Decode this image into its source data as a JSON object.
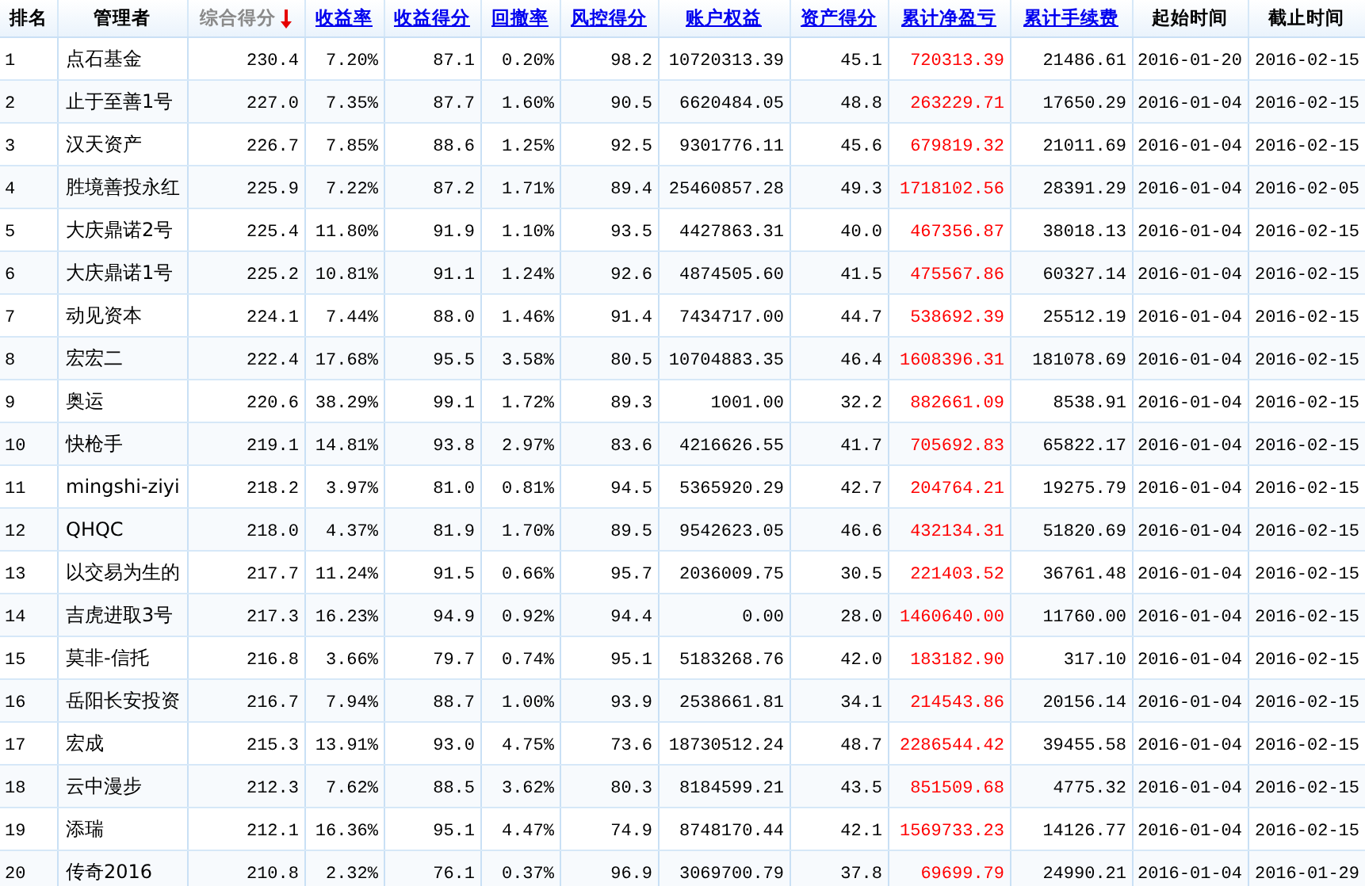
{
  "table": {
    "columns": [
      {
        "label": "排名",
        "kind": "plain",
        "highlighted": false
      },
      {
        "label": "管理者",
        "kind": "plain",
        "highlighted": false
      },
      {
        "label": "综合得分",
        "kind": "sorted",
        "highlighted": false
      },
      {
        "label": "收益率",
        "kind": "link",
        "highlighted": false
      },
      {
        "label": "收益得分",
        "kind": "link",
        "highlighted": false
      },
      {
        "label": "回撤率",
        "kind": "link",
        "highlighted": false
      },
      {
        "label": "风控得分",
        "kind": "link",
        "highlighted": false
      },
      {
        "label": "账户权益",
        "kind": "link",
        "highlighted": false
      },
      {
        "label": "资产得分",
        "kind": "link",
        "highlighted": false
      },
      {
        "label": "累计净盈亏",
        "kind": "link",
        "highlighted": true
      },
      {
        "label": "累计手续费",
        "kind": "link",
        "highlighted": false
      },
      {
        "label": "起始时间",
        "kind": "plain",
        "highlighted": false
      },
      {
        "label": "截止时间",
        "kind": "plain",
        "highlighted": false
      }
    ],
    "rows": [
      [
        "1",
        "点石基金",
        "230.4",
        "7.20%",
        "87.1",
        "0.20%",
        "98.2",
        "10720313.39",
        "45.1",
        "720313.39",
        "21486.61",
        "2016-01-20",
        "2016-02-15"
      ],
      [
        "2",
        "止于至善1号",
        "227.0",
        "7.35%",
        "87.7",
        "1.60%",
        "90.5",
        "6620484.05",
        "48.8",
        "263229.71",
        "17650.29",
        "2016-01-04",
        "2016-02-15"
      ],
      [
        "3",
        "汉天资产",
        "226.7",
        "7.85%",
        "88.6",
        "1.25%",
        "92.5",
        "9301776.11",
        "45.6",
        "679819.32",
        "21011.69",
        "2016-01-04",
        "2016-02-15"
      ],
      [
        "4",
        "胜境善投永红",
        "225.9",
        "7.22%",
        "87.2",
        "1.71%",
        "89.4",
        "25460857.28",
        "49.3",
        "1718102.56",
        "28391.29",
        "2016-01-04",
        "2016-02-05"
      ],
      [
        "5",
        "大庆鼎诺2号",
        "225.4",
        "11.80%",
        "91.9",
        "1.10%",
        "93.5",
        "4427863.31",
        "40.0",
        "467356.87",
        "38018.13",
        "2016-01-04",
        "2016-02-15"
      ],
      [
        "6",
        "大庆鼎诺1号",
        "225.2",
        "10.81%",
        "91.1",
        "1.24%",
        "92.6",
        "4874505.60",
        "41.5",
        "475567.86",
        "60327.14",
        "2016-01-04",
        "2016-02-15"
      ],
      [
        "7",
        "动见资本",
        "224.1",
        "7.44%",
        "88.0",
        "1.46%",
        "91.4",
        "7434717.00",
        "44.7",
        "538692.39",
        "25512.19",
        "2016-01-04",
        "2016-02-15"
      ],
      [
        "8",
        "宏宏二",
        "222.4",
        "17.68%",
        "95.5",
        "3.58%",
        "80.5",
        "10704883.35",
        "46.4",
        "1608396.31",
        "181078.69",
        "2016-01-04",
        "2016-02-15"
      ],
      [
        "9",
        "奥运",
        "220.6",
        "38.29%",
        "99.1",
        "1.72%",
        "89.3",
        "1001.00",
        "32.2",
        "882661.09",
        "8538.91",
        "2016-01-04",
        "2016-02-15"
      ],
      [
        "10",
        "快枪手",
        "219.1",
        "14.81%",
        "93.8",
        "2.97%",
        "83.6",
        "4216626.55",
        "41.7",
        "705692.83",
        "65822.17",
        "2016-01-04",
        "2016-02-15"
      ],
      [
        "11",
        "mingshi-ziyi",
        "218.2",
        "3.97%",
        "81.0",
        "0.81%",
        "94.5",
        "5365920.29",
        "42.7",
        "204764.21",
        "19275.79",
        "2016-01-04",
        "2016-02-15"
      ],
      [
        "12",
        "QHQC",
        "218.0",
        "4.37%",
        "81.9",
        "1.70%",
        "89.5",
        "9542623.05",
        "46.6",
        "432134.31",
        "51820.69",
        "2016-01-04",
        "2016-02-15"
      ],
      [
        "13",
        "以交易为生的",
        "217.7",
        "11.24%",
        "91.5",
        "0.66%",
        "95.7",
        "2036009.75",
        "30.5",
        "221403.52",
        "36761.48",
        "2016-01-04",
        "2016-02-15"
      ],
      [
        "14",
        "吉虎进取3号",
        "217.3",
        "16.23%",
        "94.9",
        "0.92%",
        "94.4",
        "0.00",
        "28.0",
        "1460640.00",
        "11760.00",
        "2016-01-04",
        "2016-02-15"
      ],
      [
        "15",
        "莫非-信托",
        "216.8",
        "3.66%",
        "79.7",
        "0.74%",
        "95.1",
        "5183268.76",
        "42.0",
        "183182.90",
        "317.10",
        "2016-01-04",
        "2016-02-15"
      ],
      [
        "16",
        "岳阳长安投资",
        "216.7",
        "7.94%",
        "88.7",
        "1.00%",
        "93.9",
        "2538661.81",
        "34.1",
        "214543.86",
        "20156.14",
        "2016-01-04",
        "2016-02-15"
      ],
      [
        "17",
        "宏成",
        "215.3",
        "13.91%",
        "93.0",
        "4.75%",
        "73.6",
        "18730512.24",
        "48.7",
        "2286544.42",
        "39455.58",
        "2016-01-04",
        "2016-02-15"
      ],
      [
        "18",
        "云中漫步",
        "212.3",
        "7.62%",
        "88.5",
        "3.62%",
        "80.3",
        "8184599.21",
        "43.5",
        "851509.68",
        "4775.32",
        "2016-01-04",
        "2016-02-15"
      ],
      [
        "19",
        "添瑞",
        "212.1",
        "16.36%",
        "95.1",
        "4.47%",
        "74.9",
        "8748170.44",
        "42.1",
        "1569733.23",
        "14126.77",
        "2016-01-04",
        "2016-02-15"
      ],
      [
        "20",
        "传奇2016",
        "210.8",
        "2.32%",
        "76.1",
        "0.37%",
        "96.9",
        "3069700.79",
        "37.8",
        "69699.79",
        "24990.21",
        "2016-01-04",
        "2016-01-29"
      ]
    ]
  }
}
